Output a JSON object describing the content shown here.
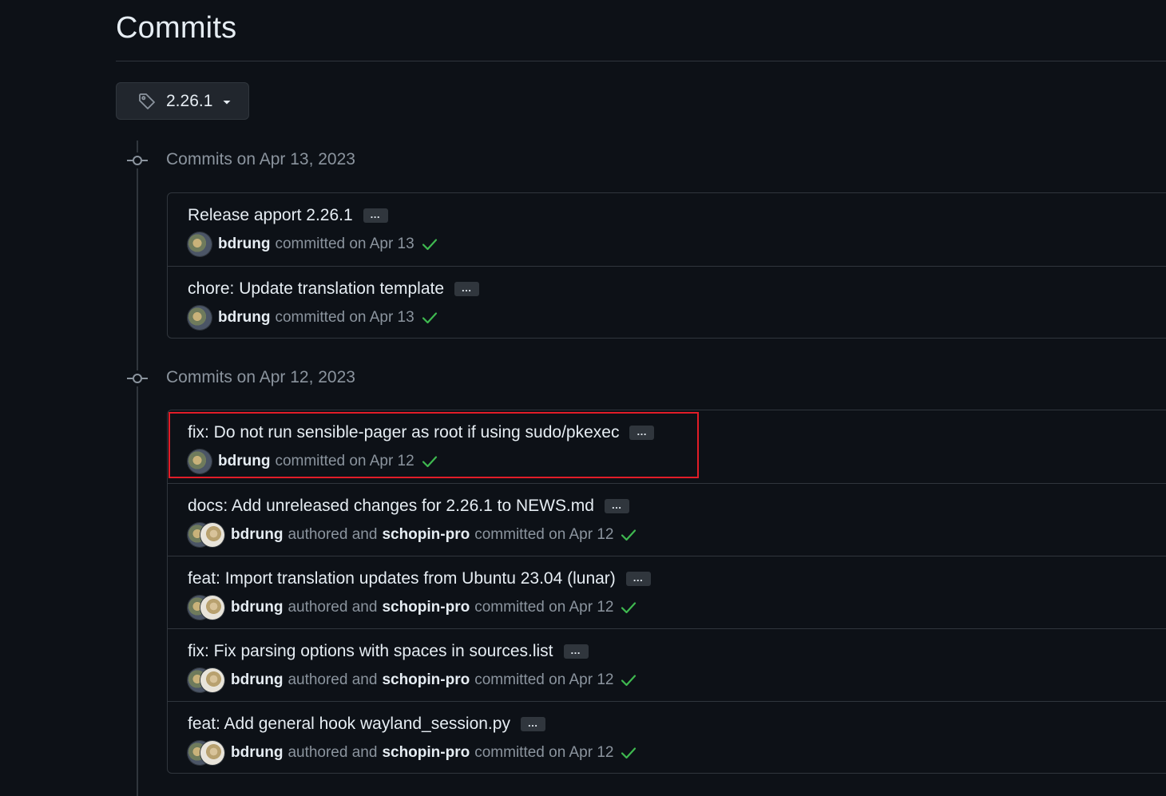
{
  "page": {
    "title": "Commits"
  },
  "branch_selector": {
    "label": "2.26.1",
    "icon": "tag-icon"
  },
  "colors": {
    "background": "#0d1117",
    "border": "#30363d",
    "success": "#3fb950",
    "highlight": "#e11d28"
  },
  "groups": [
    {
      "heading": "Commits on Apr 13, 2023",
      "commits": [
        {
          "title": "Release apport 2.26.1",
          "author": "bdrung",
          "action": "committed on Apr 13",
          "ellipsis": "…"
        },
        {
          "title": "chore: Update translation template",
          "author": "bdrung",
          "action": "committed on Apr 13",
          "ellipsis": "…"
        }
      ]
    },
    {
      "heading": "Commits on Apr 12, 2023",
      "commits": [
        {
          "title": "fix: Do not run sensible-pager as root if using sudo/pkexec",
          "author": "bdrung",
          "action": "committed on Apr 12",
          "ellipsis": "…"
        },
        {
          "title": "docs: Add unreleased changes for 2.26.1 to NEWS.md",
          "author": "bdrung",
          "authored_text": "authored and",
          "committer": "schopin-pro",
          "action": "committed on Apr 12",
          "ellipsis": "…"
        },
        {
          "title": "feat: Import translation updates from Ubuntu 23.04 (lunar)",
          "author": "bdrung",
          "authored_text": "authored and",
          "committer": "schopin-pro",
          "action": "committed on Apr 12",
          "ellipsis": "…"
        },
        {
          "title": "fix: Fix parsing options with spaces in sources.list",
          "author": "bdrung",
          "authored_text": "authored and",
          "committer": "schopin-pro",
          "action": "committed on Apr 12",
          "ellipsis": "…"
        },
        {
          "title": "feat: Add general hook wayland_session.py",
          "author": "bdrung",
          "authored_text": "authored and",
          "committer": "schopin-pro",
          "action": "committed on Apr 12",
          "ellipsis": "…"
        }
      ]
    }
  ]
}
